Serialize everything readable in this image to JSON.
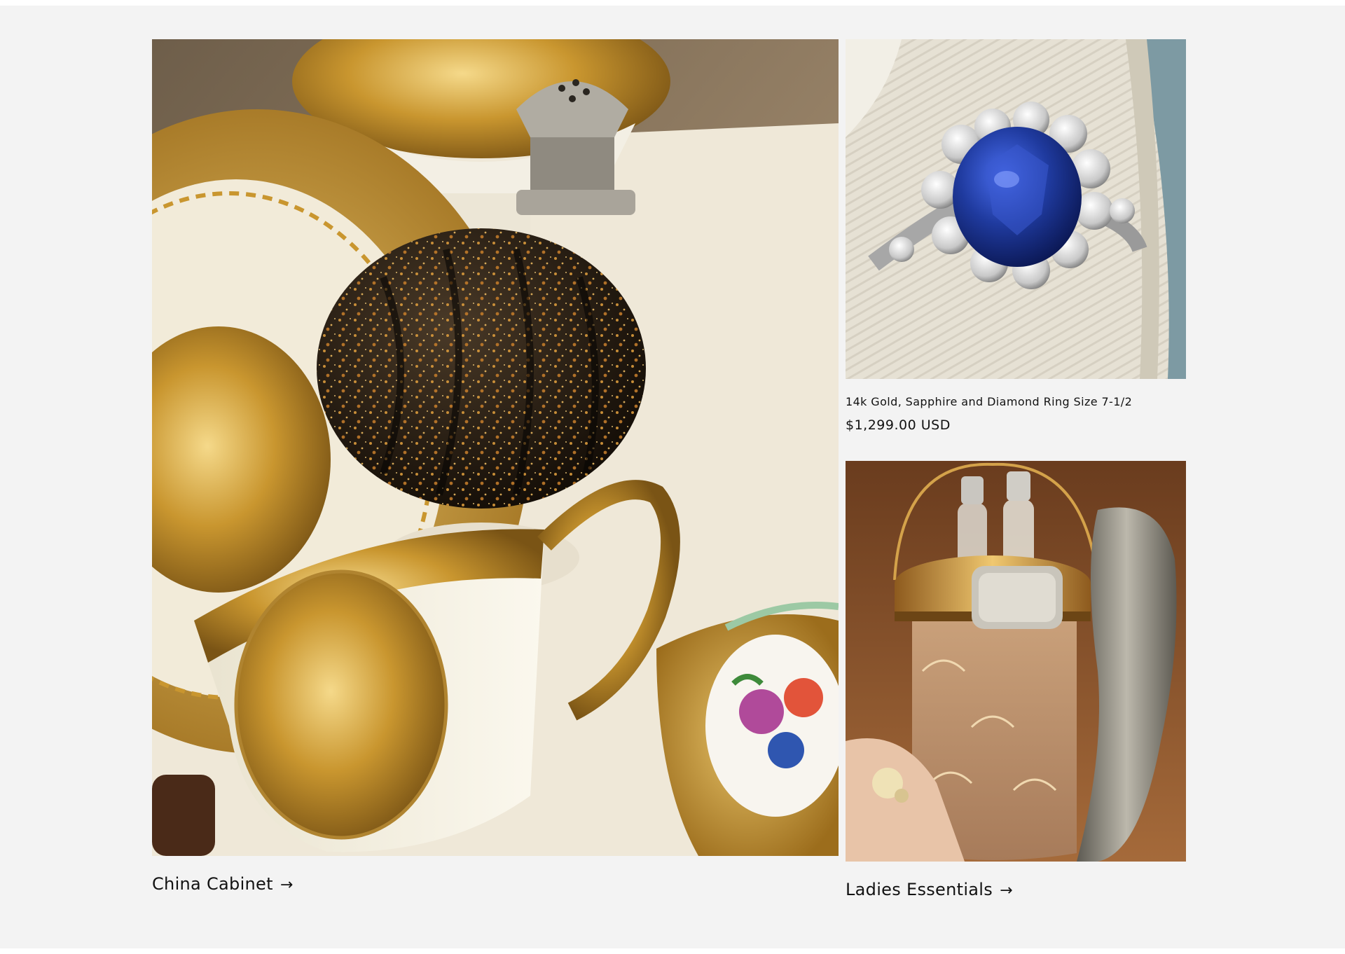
{
  "collections": [
    {
      "title": "China Cabinet"
    },
    {
      "title": "Ladies Essentials"
    }
  ],
  "product": {
    "title": "14k Gold, Sapphire and Diamond Ring Size 7-1/2",
    "price": "$1,299.00 USD"
  },
  "icons": {
    "arrow": "→"
  },
  "colors": {
    "background": "#f3f3f3",
    "text": "#121212",
    "gold": "#c9962f",
    "sapphire": "#1f3a9e"
  }
}
